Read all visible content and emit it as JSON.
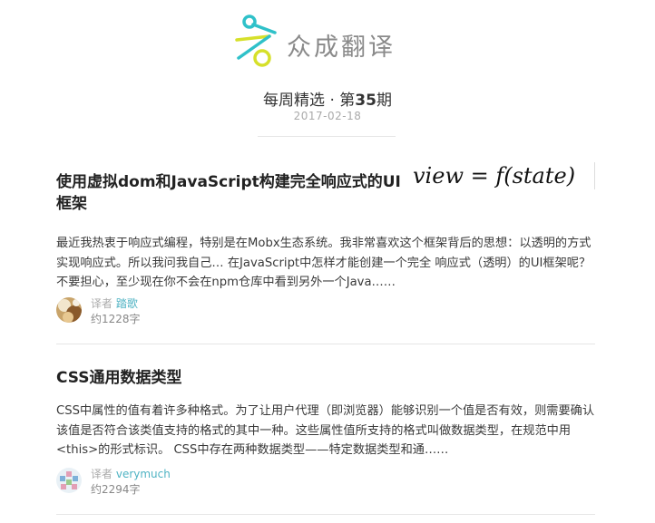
{
  "brand": {
    "name": "众成翻译",
    "colors": {
      "teal": "#2fc1c9",
      "yellow_green": "#d6e02a",
      "text_gray": "#8a8a8a"
    }
  },
  "issue": {
    "title_prefix": "每周精选 · 第",
    "number": "35",
    "title_suffix": "期",
    "date": "2017-02-18"
  },
  "articles": [
    {
      "title": "使用虚拟dom和JavaScript构建完全响应式的UI框架",
      "formula": "view = f(state)",
      "summary": "最近我热衷于响应式编程，特别是在Mobx生态系统。我非常喜欢这个框架背后的思想：以透明的方式实现响应式。所以我问我自己… 在JavaScript中怎样才能创建一个完全 响应式（透明）的UI框架呢？ 不要担心，至少现在你不会在npm仓库中看到另外一个Java……",
      "translator_label": "译者",
      "translator_name": "踏歌",
      "word_count": "约1228字",
      "avatar_icon": "avatar-photo-icon"
    },
    {
      "title": "CSS通用数据类型",
      "summary": "CSS中属性的值有着许多种格式。为了让用户代理（即浏览器）能够识别一个值是否有效，则需要确认该值是否符合该类值支持的格式的其中一种。这些属性值所支持的格式叫做数据类型，在规范中用<this>的形式标识。 CSS中存在两种数据类型——特定数据类型和通……",
      "translator_label": "译者",
      "translator_name": "verymuch",
      "word_count": "约2294字",
      "avatar_icon": "avatar-identicon-icon"
    }
  ]
}
